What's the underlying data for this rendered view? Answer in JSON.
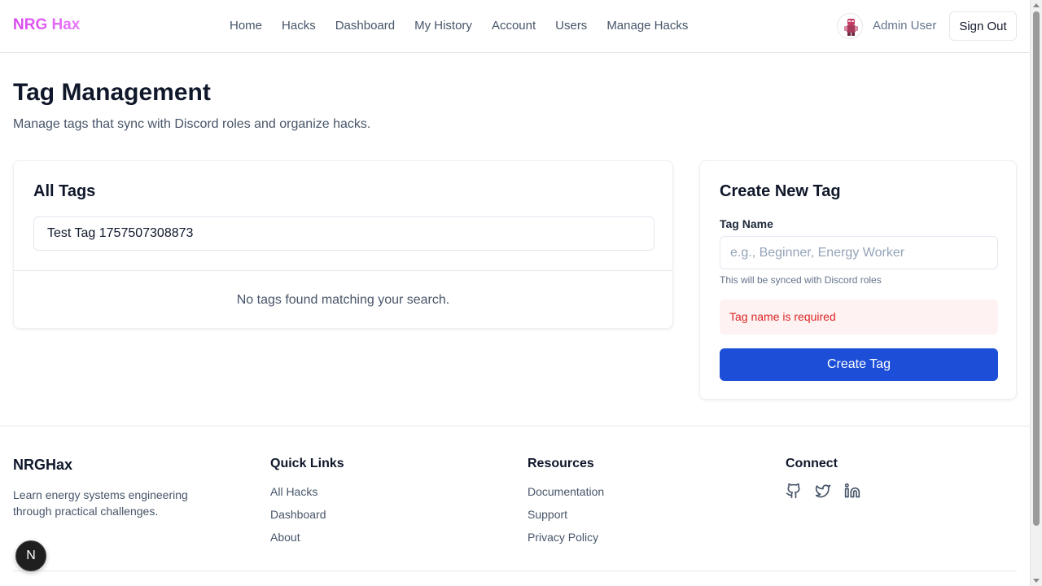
{
  "header": {
    "brand": "NRG Hax",
    "nav": [
      "Home",
      "Hacks",
      "Dashboard",
      "My History",
      "Account",
      "Users",
      "Manage Hacks"
    ],
    "user_name": "Admin User",
    "sign_out_label": "Sign Out",
    "avatar_icon": "avatar-character-icon"
  },
  "main": {
    "title": "Tag Management",
    "subtitle": "Manage tags that sync with Discord roles and organize hacks."
  },
  "all_tags": {
    "title": "All Tags",
    "search_value": "Test Tag 1757507308873",
    "empty_message": "No tags found matching your search."
  },
  "create_tag": {
    "title": "Create New Tag",
    "field_label": "Tag Name",
    "placeholder": "e.g., Beginner, Energy Worker",
    "help_text": "This will be synced with Discord roles",
    "error": "Tag name is required",
    "button_label": "Create Tag"
  },
  "footer": {
    "brand": "NRGHax",
    "description": "Learn energy systems engineering through practical challenges.",
    "quick_links_title": "Quick Links",
    "quick_links": [
      "All Hacks",
      "Dashboard",
      "About"
    ],
    "resources_title": "Resources",
    "resources": [
      "Documentation",
      "Support",
      "Privacy Policy"
    ],
    "connect_title": "Connect",
    "social_icons": [
      "github-icon",
      "twitter-icon",
      "linkedin-icon"
    ]
  },
  "badge": {
    "letter": "N"
  },
  "colors": {
    "brand_gradient_start": "#d946ef",
    "primary_button": "#1d4ed8",
    "error_text": "#dc2626",
    "error_bg": "#fef2f2"
  }
}
